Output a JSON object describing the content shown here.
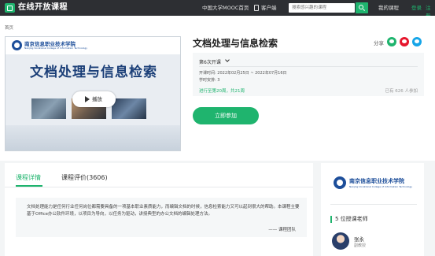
{
  "header": {
    "logo_text": "在线开放课程",
    "links": [
      "中国大学MOOC首页",
      "客户端"
    ],
    "search_placeholder": "搜索感兴趣的课程",
    "my_courses": "我的课程",
    "login": "登录",
    "register": "注册"
  },
  "breadcrumb": "首页",
  "cover": {
    "school_name": "南京信息职业技术学院",
    "school_sub": "Nanjing Vocational College of Information Technology",
    "title": "文档处理与信息检索",
    "play_label": "播放"
  },
  "course": {
    "title": "文档处理与信息检索",
    "share_label": "分享",
    "term": "第6次开课",
    "open_time": "开课时间:  2022年02月25日 ~ 2022年07月16日",
    "study_load": "学时安排:  3",
    "progress": "进行至第20周，共21周",
    "enrolled": "已有 626 人参加",
    "join_button": "立即参加"
  },
  "tabs": [
    "课程详情",
    "课程评价(3606)"
  ],
  "description": {
    "text": "文档处理能力是任何行业任何岗位都需要具备的一项基本职业素质能力，而编辑文档的时候，信息检索能力又可以起到很大的帮助。本课程主要基于Office办公软件环境，以项目为导向，以任务为驱动，讲授典型的办公文档的编辑处理方法。",
    "signature": "—— 课程团队"
  },
  "sidebar": {
    "school_name": "南京信息职业技术学院",
    "school_sub": "Nanjing Vocational College of Information Technology",
    "teachers_heading": "5 位授课老师",
    "teacher_name": "张永",
    "teacher_title": "副教授"
  },
  "colors": {
    "accent": "#1fb46e",
    "topbar": "#2d2f33",
    "school_blue": "#1d4e9a"
  }
}
